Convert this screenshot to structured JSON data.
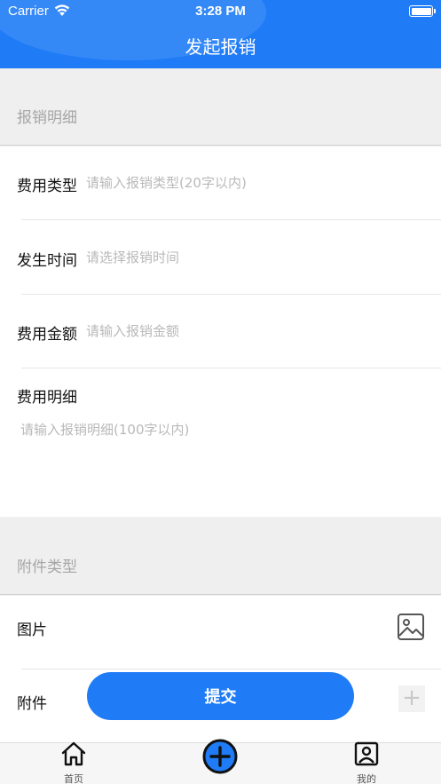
{
  "status_bar": {
    "carrier": "Carrier",
    "time": "3:28 PM"
  },
  "header": {
    "title": "发起报销"
  },
  "sections": {
    "details_title": "报销明细",
    "attachments_title": "附件类型"
  },
  "form": {
    "expense_type": {
      "label": "费用类型",
      "placeholder": "请输入报销类型(20字以内)",
      "value": ""
    },
    "time": {
      "label": "发生时间",
      "placeholder": "请选择报销时间",
      "value": ""
    },
    "amount": {
      "label": "费用金额",
      "placeholder": "请输入报销金额",
      "value": ""
    },
    "detail": {
      "label": "费用明细",
      "placeholder": "请输入报销明细(100字以内)",
      "value": ""
    }
  },
  "attachments": {
    "image_label": "图片",
    "file_label": "附件",
    "image_icon": "image-icon",
    "add_icon": "plus-icon"
  },
  "submit_label": "提交",
  "tabbar": {
    "home_label": "首页",
    "center_icon": "add-circle-icon",
    "me_label": "我的"
  },
  "colors": {
    "accent": "#1f7cf6",
    "background": "#efefef"
  }
}
